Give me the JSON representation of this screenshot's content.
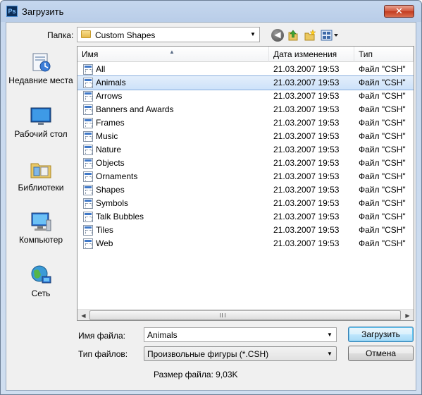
{
  "window": {
    "app_icon": "Ps",
    "title": "Загрузить",
    "close_label": "✕"
  },
  "lookin": {
    "label": "Папка:",
    "value": "Custom Shapes",
    "icon": "folder-icon"
  },
  "toolbar": {
    "back_icon": "back-arrow-icon",
    "up_icon": "up-folder-icon",
    "newfolder_icon": "new-folder-icon",
    "views_icon": "views-menu-icon"
  },
  "places": [
    {
      "label": "Недавние места",
      "icon": "recent-places-icon"
    },
    {
      "label": "Рабочий стол",
      "icon": "desktop-icon"
    },
    {
      "label": "Библиотеки",
      "icon": "libraries-icon"
    },
    {
      "label": "Компьютер",
      "icon": "computer-icon"
    },
    {
      "label": "Сеть",
      "icon": "network-icon"
    }
  ],
  "columns": {
    "name": "Имя",
    "date": "Дата изменения",
    "type": "Тип"
  },
  "files": [
    {
      "name": "All",
      "date": "21.03.2007 19:53",
      "type": "Файл \"CSH\""
    },
    {
      "name": "Animals",
      "date": "21.03.2007 19:53",
      "type": "Файл \"CSH\""
    },
    {
      "name": "Arrows",
      "date": "21.03.2007 19:53",
      "type": "Файл \"CSH\""
    },
    {
      "name": "Banners and Awards",
      "date": "21.03.2007 19:53",
      "type": "Файл \"CSH\""
    },
    {
      "name": "Frames",
      "date": "21.03.2007 19:53",
      "type": "Файл \"CSH\""
    },
    {
      "name": "Music",
      "date": "21.03.2007 19:53",
      "type": "Файл \"CSH\""
    },
    {
      "name": "Nature",
      "date": "21.03.2007 19:53",
      "type": "Файл \"CSH\""
    },
    {
      "name": "Objects",
      "date": "21.03.2007 19:53",
      "type": "Файл \"CSH\""
    },
    {
      "name": "Ornaments",
      "date": "21.03.2007 19:53",
      "type": "Файл \"CSH\""
    },
    {
      "name": "Shapes",
      "date": "21.03.2007 19:53",
      "type": "Файл \"CSH\""
    },
    {
      "name": "Symbols",
      "date": "21.03.2007 19:53",
      "type": "Файл \"CSH\""
    },
    {
      "name": "Talk Bubbles",
      "date": "21.03.2007 19:53",
      "type": "Файл \"CSH\""
    },
    {
      "name": "Tiles",
      "date": "21.03.2007 19:53",
      "type": "Файл \"CSH\""
    },
    {
      "name": "Web",
      "date": "21.03.2007 19:53",
      "type": "Файл \"CSH\""
    }
  ],
  "selected_file": "Animals",
  "filename": {
    "label": "Имя файла:",
    "value": "Animals"
  },
  "filetype": {
    "label": "Тип файлов:",
    "value": "Произвольные фигуры (*.CSH)"
  },
  "buttons": {
    "open": "Загрузить",
    "cancel": "Отмена"
  },
  "filesize": "Размер файла: 9,03K",
  "colors": {
    "selection": "#cde2fa",
    "title_gradient": "#b9cde8",
    "close": "#c23b1f"
  }
}
